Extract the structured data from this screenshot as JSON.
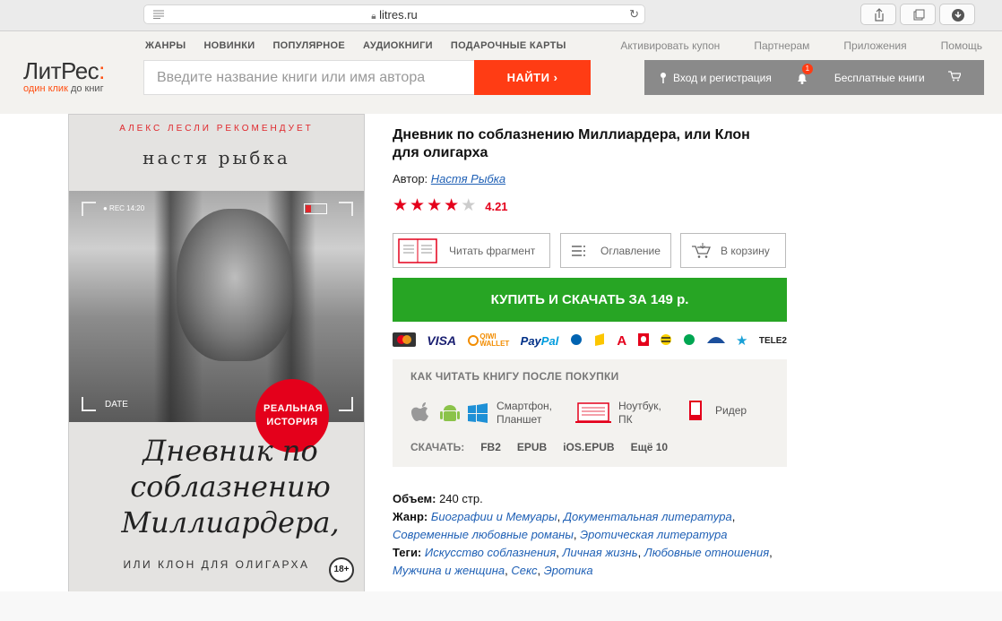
{
  "browser": {
    "url": "litres.ru"
  },
  "header": {
    "nav": [
      "ЖАНРЫ",
      "НОВИНКИ",
      "ПОПУЛЯРНОЕ",
      "АУДИОКНИГИ",
      "ПОДАРОЧНЫЕ КАРТЫ"
    ],
    "right_nav": [
      "Активировать купон",
      "Партнерам",
      "Приложения",
      "Помощь"
    ],
    "logo_main_a": "Лит",
    "logo_main_b": "Рес",
    "logo_colon": ":",
    "logo_tag_a": "один клик",
    "logo_tag_b": "до книг",
    "search_placeholder": "Введите название книги или имя автора",
    "search_button": "НАЙТИ",
    "search_chevron": "›",
    "login": "Вход и регистрация",
    "notif_count": "1",
    "free_books": "Бесплатные книги"
  },
  "cover": {
    "recommend": "АЛЕКС ЛЕСЛИ РЕКОМЕНДУЕТ",
    "author": "настя рыбка",
    "rec_label": "● REC  14:20",
    "date_label": "DATE",
    "badge": "РЕАЛЬНАЯ ИСТОРИЯ",
    "title": "Дневник по соблазнению Миллиардера,",
    "subtitle": "ИЛИ КЛОН ДЛЯ ОЛИГАРХА",
    "age": "18+"
  },
  "book": {
    "title": "Дневник по соблазнению Миллиардера, или Клон для олигарха",
    "author_label": "Автор:",
    "author": "Настя Рыбка",
    "rating": "4.21",
    "stars_filled": 4,
    "stars_total": 5
  },
  "actions": {
    "read": "Читать фрагмент",
    "toc": "Оглавление",
    "cart": "В корзину",
    "buy": "КУПИТЬ И СКАЧАТЬ ЗА 149 р."
  },
  "payments": [
    "MasterCard",
    "VISA",
    "QIWI WALLET",
    "PayPal",
    "WebMoney",
    "Яндекс",
    "Альфа",
    "МТС",
    "Билайн",
    "Мегафон",
    "Банк",
    "Звезда",
    "TELE2"
  ],
  "how_to_read": {
    "heading": "КАК ЧИТАТЬ КНИГУ ПОСЛЕ ПОКУПКИ",
    "smartphone": "Смартфон, Планшет",
    "laptop": "Ноутбук, ПК",
    "reader": "Ридер",
    "download_label": "СКАЧАТЬ:",
    "formats": [
      "FB2",
      "EPUB",
      "iOS.EPUB",
      "Ещё 10"
    ]
  },
  "meta": {
    "volume_label": "Объем:",
    "volume": "240 стр.",
    "genre_label": "Жанр:",
    "genres": [
      "Биографии и Мемуары",
      "Документальная литература",
      "Современные любовные романы",
      "Эротическая литература"
    ],
    "tags_label": "Теги:",
    "tags": [
      "Искусство соблазнения",
      "Личная жизнь",
      "Любовные отношения",
      "Мужчина и женщина",
      "Секс",
      "Эротика"
    ]
  },
  "colors": {
    "brand_orange": "#ff4f12",
    "search_red": "#ff3c14",
    "buy_green": "#27a524",
    "link_blue": "#1f60b5",
    "star_red": "#e4001b"
  }
}
